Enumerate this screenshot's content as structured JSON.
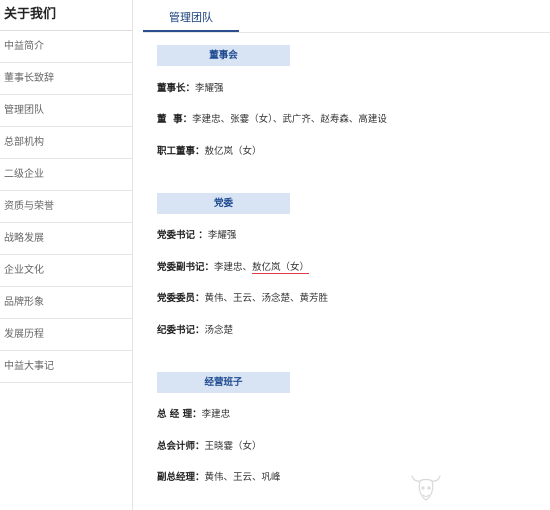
{
  "sidebar": {
    "title": "关于我们",
    "items": [
      {
        "label": "中益简介"
      },
      {
        "label": "董事长致辞"
      },
      {
        "label": "管理团队"
      },
      {
        "label": "总部机构"
      },
      {
        "label": "二级企业"
      },
      {
        "label": "资质与荣誉"
      },
      {
        "label": "战略发展"
      },
      {
        "label": "企业文化"
      },
      {
        "label": "品牌形象"
      },
      {
        "label": "发展历程"
      },
      {
        "label": "中益大事记"
      }
    ]
  },
  "tabs": {
    "active_label": "管理团队"
  },
  "board": {
    "header": "董事会",
    "chairman_label": "董事长：",
    "chairman_value": "李耀强",
    "directors_label": "董  事：",
    "directors_value": "李建忠、张霎（女）、武广齐、赵寿森、高建设",
    "staff_director_label": "职工董事：",
    "staff_director_value": "敖亿岚（女）"
  },
  "party": {
    "header": "党委",
    "secretary_label": "党委书记 ：",
    "secretary_value": "李耀强",
    "deputy_label": "党委副书记：",
    "deputy_value_1": "李建忠、",
    "deputy_value_2": "敖亿岚（女）",
    "members_label": "党委委员：",
    "members_value": "黄伟、王云、汤念楚、黄芳胜",
    "discipline_label": "纪委书记：",
    "discipline_value": "汤念楚"
  },
  "management": {
    "header": "经营班子",
    "gm_label": "总 经 理：",
    "gm_value": "李建忠",
    "accountant_label": "总会计师：",
    "accountant_value": "王晓霎（女）",
    "deputy_gm_label": "副总经理：",
    "deputy_gm_value": "黄伟、王云、巩峰"
  },
  "colors": {
    "accent": "#1f4a90",
    "header_bg": "#d8e4f4",
    "underline": "#e0394a"
  },
  "icons": {
    "watermark": "bull-logo-icon"
  }
}
